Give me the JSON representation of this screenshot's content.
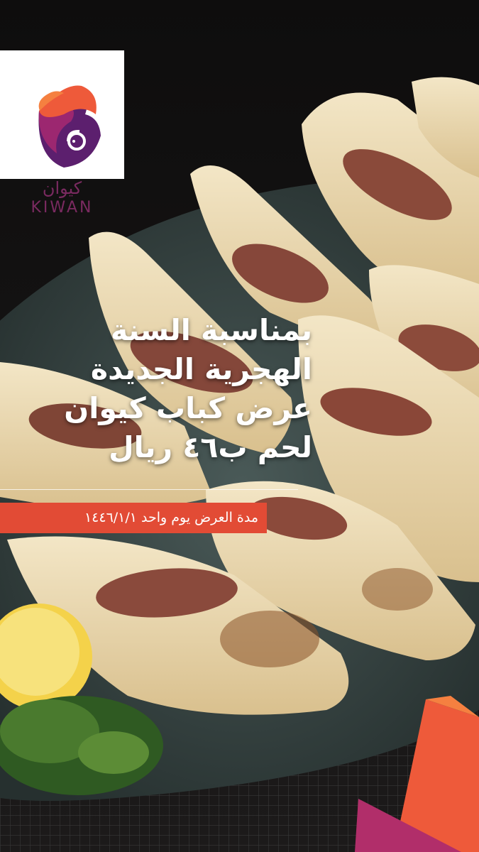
{
  "brand": {
    "name_ar": "كيوان",
    "name_en": "KIWAN"
  },
  "headline": {
    "line1": "بمناسبة السنة",
    "line2": "الهجرية الجديدة",
    "line3": "عرض كباب كيوان",
    "line4": "لحم ب٤٦ ريال"
  },
  "banner": {
    "text": "مدة العرض يوم واحد ١٤٤٦/١/١"
  },
  "colors": {
    "banner": "#e24b35",
    "brand_purple": "#7a2a60",
    "brand_orange": "#ee5a3a"
  }
}
